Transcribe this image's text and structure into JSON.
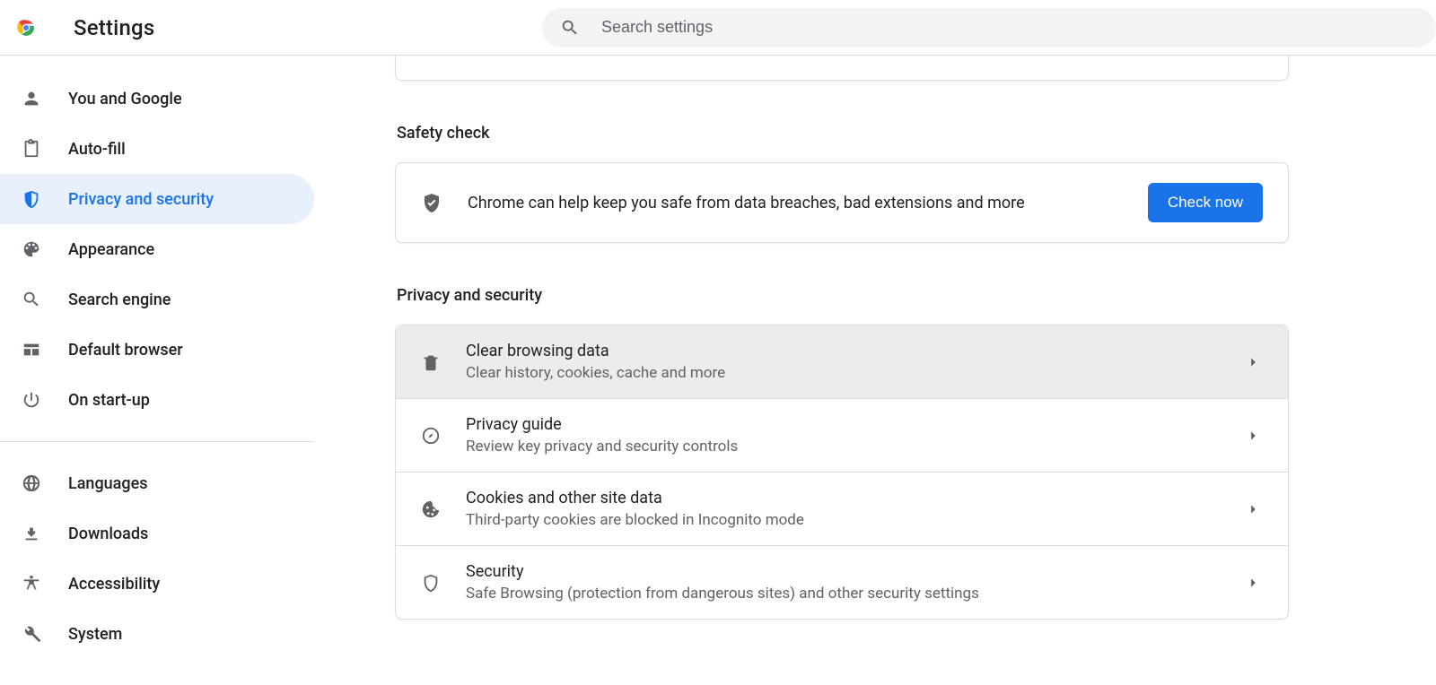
{
  "header": {
    "title": "Settings",
    "search_placeholder": "Search settings"
  },
  "sidebar": {
    "groups": [
      [
        {
          "id": "you-and-google",
          "label": "You and Google",
          "icon": "person-icon"
        },
        {
          "id": "auto-fill",
          "label": "Auto-fill",
          "icon": "clipboard-icon"
        },
        {
          "id": "privacy-and-security",
          "label": "Privacy and security",
          "icon": "shield-half-icon",
          "active": true
        },
        {
          "id": "appearance",
          "label": "Appearance",
          "icon": "palette-icon"
        },
        {
          "id": "search-engine",
          "label": "Search engine",
          "icon": "search-icon"
        },
        {
          "id": "default-browser",
          "label": "Default browser",
          "icon": "browser-icon"
        },
        {
          "id": "on-start-up",
          "label": "On start-up",
          "icon": "power-icon"
        }
      ],
      [
        {
          "id": "languages",
          "label": "Languages",
          "icon": "globe-icon"
        },
        {
          "id": "downloads",
          "label": "Downloads",
          "icon": "download-icon"
        },
        {
          "id": "accessibility",
          "label": "Accessibility",
          "icon": "accessibility-icon"
        },
        {
          "id": "system",
          "label": "System",
          "icon": "wrench-icon"
        }
      ]
    ]
  },
  "safety_check": {
    "title": "Safety check",
    "message": "Chrome can help keep you safe from data breaches, bad extensions and more",
    "button": "Check now"
  },
  "privacy": {
    "title": "Privacy and security",
    "rows": [
      {
        "id": "clear-browsing-data",
        "title": "Clear browsing data",
        "sub": "Clear history, cookies, cache and more",
        "icon": "trash-icon",
        "hover": true
      },
      {
        "id": "privacy-guide",
        "title": "Privacy guide",
        "sub": "Review key privacy and security controls",
        "icon": "compass-icon"
      },
      {
        "id": "cookies",
        "title": "Cookies and other site data",
        "sub": "Third-party cookies are blocked in Incognito mode",
        "icon": "cookie-icon"
      },
      {
        "id": "security",
        "title": "Security",
        "sub": "Safe Browsing (protection from dangerous sites) and other security settings",
        "icon": "shield-outline-icon"
      }
    ]
  },
  "colors": {
    "accent": "#1a73e8"
  }
}
